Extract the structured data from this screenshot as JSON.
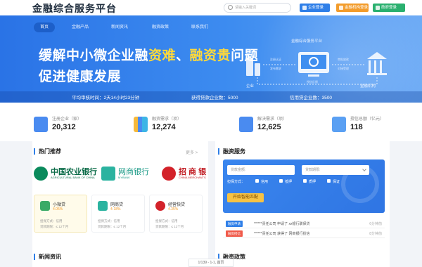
{
  "header": {
    "logo": "金融综合服务平台",
    "search_placeholder": "请输入关键词",
    "buttons": [
      "企业登录",
      "金融机构登录",
      "政府登录"
    ]
  },
  "nav": [
    "首页",
    "金融产品",
    "新闻资讯",
    "融资政策",
    "联系我们"
  ],
  "hero": {
    "line1_a": "缓解中小微企业融",
    "line1_b": "资难",
    "line1_c": "、",
    "line1_d": "融资贵",
    "line1_e": "问题",
    "line2": "促进健康发展"
  },
  "diagram": {
    "platform": "金融综合服务平台",
    "enterprise": "企业",
    "institution": "金融机构",
    "small_left_top": "注册认证",
    "small_left_bottom": "发布需求",
    "small_right_top": "审批放款",
    "small_right_bottom": "对接受理",
    "small_bottom": "授信反馈"
  },
  "stats": {
    "avg_review": "平均审核时间：2天14小时23分钟",
    "loan_companies": "获得贷款企业数：5000",
    "credit_companies": "信用贷企业数：3500"
  },
  "kpis": [
    {
      "label": "注册企业（家）",
      "value": "20,312"
    },
    {
      "label": "融资需求（项）",
      "value": "12,274"
    },
    {
      "label": "解决需求（项）",
      "value": "12,625"
    },
    {
      "label": "授信总额（亿元）",
      "value": "118"
    }
  ],
  "hot": {
    "title": "热门推荐",
    "more": "更多 >",
    "banks": [
      {
        "name": "中国农业银行",
        "sub": "AGRICULTURAL BANK OF CHINA"
      },
      {
        "name": "网商银行",
        "sub": "MYBANK"
      },
      {
        "name": "招 商 银",
        "sub": "CHINA MERCHANTS"
      }
    ],
    "products": [
      {
        "name": "小微贷",
        "rate": "4.05%",
        "line1": "担保方式：信用",
        "line2": "贷款期限：≤ 12个月"
      },
      {
        "name": "网商贷",
        "rate": "4-18%",
        "line1": "担保方式：信用",
        "line2": "贷款期限：≤ 12个月"
      },
      {
        "name": "经营快贷",
        "rate": "4.35%",
        "line1": "担保方式：信用",
        "line2": "贷款期限：≤ 12个月"
      }
    ]
  },
  "finance": {
    "title": "融资服务",
    "amount_placeholder": "贷款金额:",
    "term_placeholder": "贷款期限:",
    "guarantee_label": "担保方式：",
    "options": [
      "信用",
      "抵押",
      "质押",
      "保证"
    ],
    "button": "开始智能匹配",
    "rows": [
      {
        "tag": "融资申请",
        "tag_color": "#2f7fe8",
        "msg": "******责任公司 申请了 xx银行联保贷",
        "time": "6分钟前"
      },
      {
        "tag": "融资授信",
        "tag_color": "#f05a4a",
        "msg": "******责任公司 获得了 网商银行授信",
        "time": "8分钟前"
      }
    ]
  },
  "news_title": "新闻资讯",
  "policy_title": "融资政策",
  "pager": "1/139 - 1-1,  首页"
}
